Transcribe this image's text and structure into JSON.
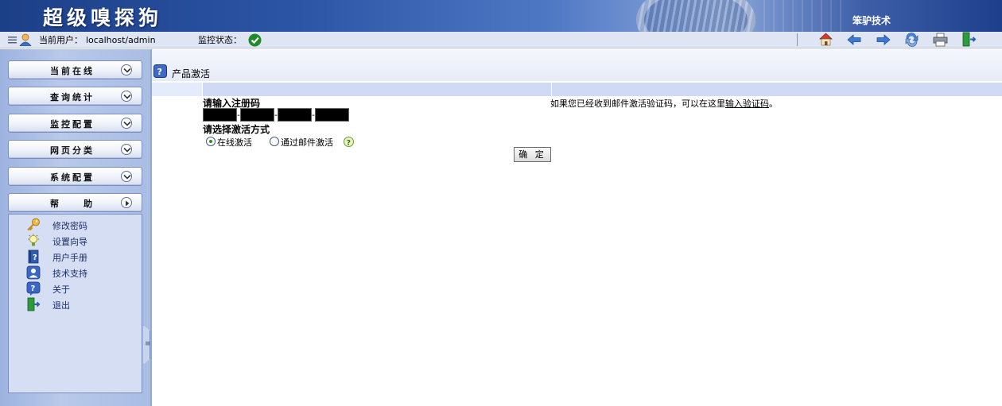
{
  "banner": {
    "title": "超级嗅探狗",
    "company": "笨驴技术"
  },
  "status": {
    "user_label": "当前用户：",
    "user_value": "localhost/admin",
    "monitor_label": "监控状态：",
    "monitor_state_icon": "check-circle-icon"
  },
  "toolbar": {
    "icons": [
      "home-icon",
      "back-arrow-icon",
      "forward-arrow-icon",
      "refresh-icon",
      "print-icon",
      "exit-door-icon"
    ]
  },
  "nav": {
    "items": [
      {
        "label": "当前在线",
        "icon": "chevron-down-icon"
      },
      {
        "label": "查询统计",
        "icon": "chevron-down-icon"
      },
      {
        "label": "监控配置",
        "icon": "chevron-down-icon"
      },
      {
        "label": "网页分类",
        "icon": "chevron-down-icon"
      },
      {
        "label": "系统配置",
        "icon": "chevron-down-icon"
      },
      {
        "label": "帮　　助",
        "icon": "chevron-right-icon"
      }
    ],
    "help_items": [
      {
        "label": "修改密码",
        "icon": "key-icon"
      },
      {
        "label": "设置向导",
        "icon": "lightbulb-icon"
      },
      {
        "label": "用户手册",
        "icon": "manual-book-icon"
      },
      {
        "label": "技术支持",
        "icon": "support-person-icon"
      },
      {
        "label": "关于",
        "icon": "about-question-icon"
      },
      {
        "label": "退出",
        "icon": "exit-door-icon"
      }
    ]
  },
  "page": {
    "title": "产品激活",
    "reg_code_label": "请输入注册码",
    "code_separator": "-",
    "activation_mode_label": "请选择激活方式",
    "options": [
      {
        "label": "在线激活",
        "selected": true
      },
      {
        "label": "通过邮件激活",
        "selected": false
      }
    ],
    "ok_button": "确 定",
    "hint_prefix": "如果您已经收到邮件激活验证码，可以在这里",
    "hint_link": "输入验证码",
    "hint_suffix": "。"
  },
  "colors": {
    "banner_dark": "#1c3f87",
    "panel_blue": "#a9bde4",
    "accent_green": "#2c8d2c"
  }
}
